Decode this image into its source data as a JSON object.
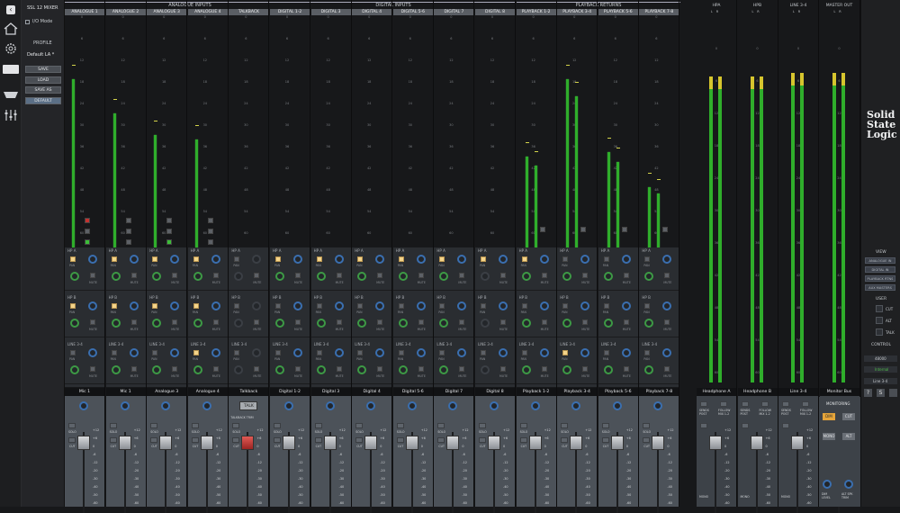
{
  "app": {
    "title": "SSL 12 MIXER",
    "io_mode": "I/O Mode",
    "profile_label": "PROFILE",
    "profile_name": "Default LA *",
    "buttons": [
      "SAVE",
      "LOAD",
      "SAVE AS",
      "DEFAULT"
    ]
  },
  "groups": [
    {
      "label": "ANALOGUE INPUTS"
    },
    {
      "label": "DIGITAL INPUTS"
    },
    {
      "label": "PLAYBACK RETURNS"
    }
  ],
  "channels": [
    {
      "head": "ANALOGUE 1",
      "name": "Mic 1",
      "level": 0.78
    },
    {
      "head": "ANALOGUE 2",
      "name": "Mic 1",
      "level": 0.62
    },
    {
      "head": "ANALOGUE 3",
      "name": "Analogue 3",
      "level": 0.52
    },
    {
      "head": "ANALOGUE 4",
      "name": "Analogue 4",
      "level": 0.5
    },
    {
      "head": "TALKBACK",
      "name": "Talkback",
      "level": 0
    },
    {
      "head": "DIGITAL 1-2",
      "name": "Digital 1-2",
      "level": 0
    },
    {
      "head": "DIGITAL 3",
      "name": "Digital 3",
      "level": 0
    },
    {
      "head": "DIGITAL 4",
      "name": "Digital 4",
      "level": 0
    },
    {
      "head": "DIGITAL 5-6",
      "name": "Digital 5-6",
      "level": 0
    },
    {
      "head": "DIGITAL 7",
      "name": "Digital 7",
      "level": 0
    },
    {
      "head": "DIGITAL 8",
      "name": "Digital 8",
      "level": 0
    },
    {
      "head": "PLAYBACK 1-2",
      "name": "Playback 1-2",
      "level": 0.42
    },
    {
      "head": "PLAYBACK 3-4",
      "name": "Playback 3-4",
      "level": 0.78
    },
    {
      "head": "PLAYBACK 5-6",
      "name": "Playback 5-6",
      "level": 0.44
    },
    {
      "head": "PLAYBACK 7-8",
      "name": "Playback 7-8",
      "level": 0.28
    }
  ],
  "sends": [
    "HP A",
    "HP B",
    "LINE 3-4"
  ],
  "labels": {
    "pan": "PAN",
    "mute": "MUTE",
    "solo": "SOLO",
    "cut": "CUT",
    "talk": "TALK",
    "talkback_trim": "TALKBACK TRIM",
    "line": "LINE",
    "inst": "+48V",
    "lr": "L    R",
    "direct": "DIRECT",
    "hpf": "HPF"
  },
  "fader_scale": [
    "+12",
    "+6",
    "0",
    "-6",
    "-12",
    "-20",
    "-30",
    "-40",
    "-50",
    "-60"
  ],
  "meter_scale": [
    "0",
    "6",
    "12",
    "18",
    "24",
    "30",
    "36",
    "42",
    "48",
    "54",
    "60"
  ],
  "outputs": [
    {
      "head": "HPA",
      "name": "Headphone A",
      "level": 0.92
    },
    {
      "head": "HPB",
      "name": "Headphone B",
      "level": 0.92
    },
    {
      "head": "LINE 3-4",
      "name": "Line 3-4",
      "level": 0.93
    },
    {
      "head": "MASTER OUT",
      "name": "Monitor Bus",
      "level": 0.93
    }
  ],
  "out_labels": {
    "sends_post": "SENDS POST",
    "follow": "FOLLOW MIX 1-2",
    "mono": "MONO",
    "master_fader": "MASTER FADER",
    "monitoring": "MONITORING",
    "dim": "DIM",
    "cut": "CUT",
    "mono_m": "MONO",
    "alt": "ALT",
    "dim_level": "DIM LEVEL",
    "alt_spk_trim": "ALT SPK TRIM"
  },
  "ssl": {
    "logo": [
      "Solid",
      "State",
      "Logic"
    ],
    "view": "VIEW",
    "view_items": [
      "ANALOGUE IN",
      "DIGITAL IN",
      "PLAYBACK RTNS",
      "AUX MASTERS"
    ],
    "user": "USER",
    "user_items": [
      "CUT",
      "ALT",
      "TALK"
    ],
    "control": "CONTROL",
    "sample_rate": "48000",
    "sync_label": "Internal",
    "route": "Line 3-4"
  },
  "colors": {
    "meter_green": "#2fae2b",
    "meter_yellow": "#d6c52e",
    "knob_blue": "#3a6fb0",
    "knob_green": "#3d9a45",
    "button_amber": "#f4d48a",
    "talk_red": "#c4312f"
  }
}
